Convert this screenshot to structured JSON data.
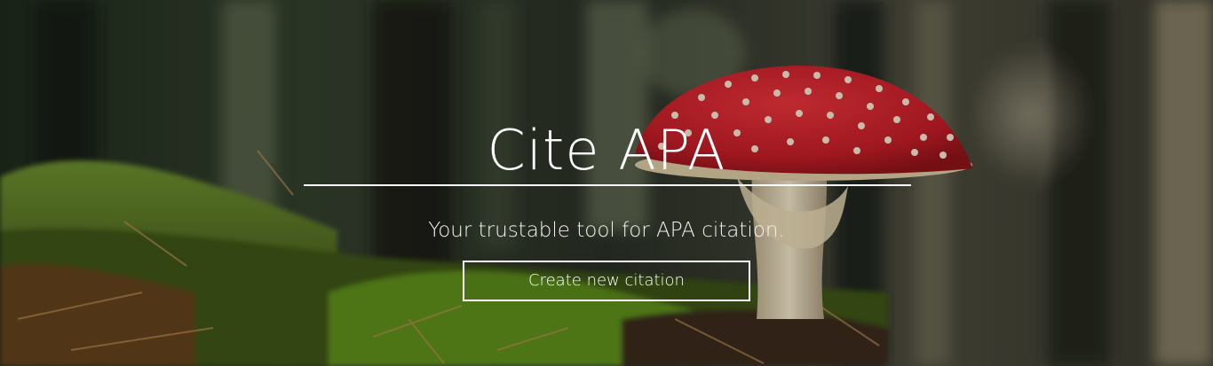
{
  "hero": {
    "title": "Cite APA",
    "tagline": "Your trustable tool for APA citation.",
    "cta_label": "Create new citation",
    "background": "forest floor photo with red fly agaric mushroom",
    "colors": {
      "text": "#ffffff",
      "mushroom_cap": "#c8202a",
      "moss": "#4f7a23"
    }
  }
}
